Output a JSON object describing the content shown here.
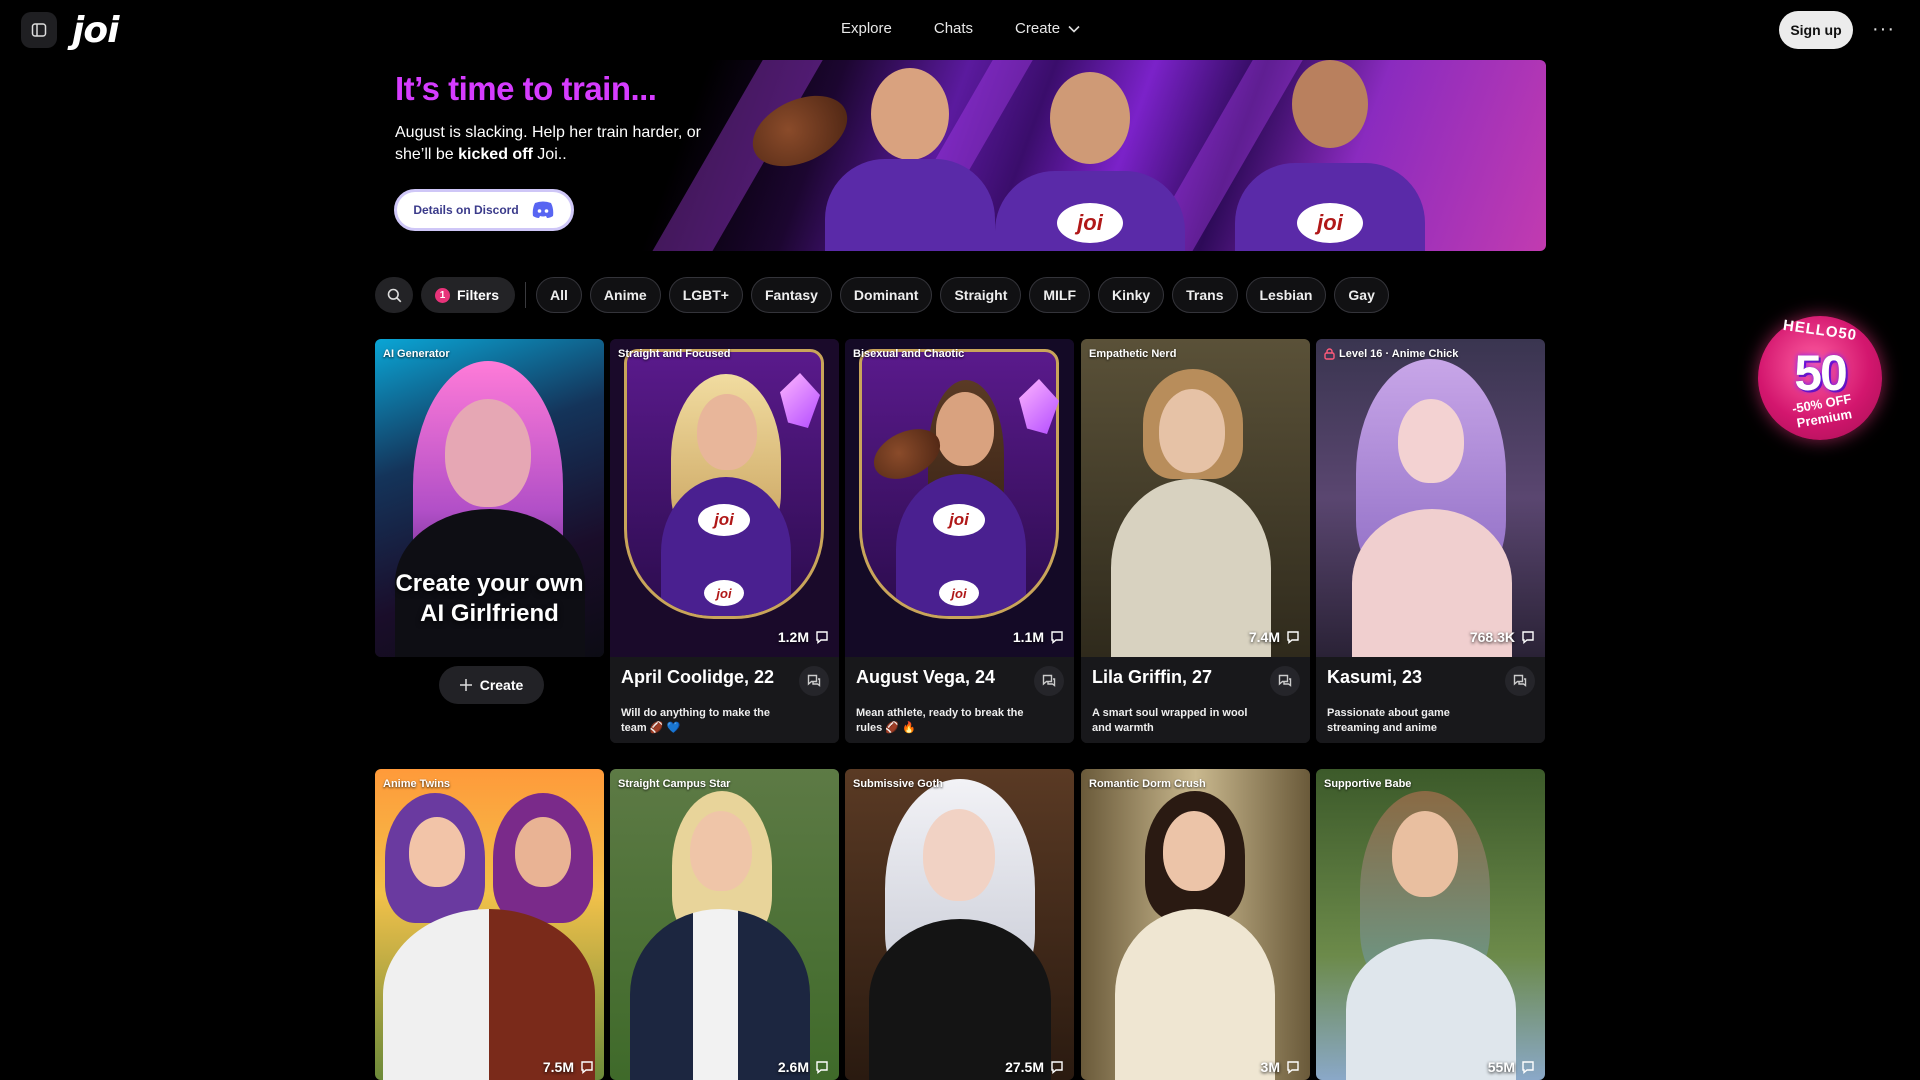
{
  "header": {
    "logo": "joi",
    "nav": [
      {
        "label": "Explore"
      },
      {
        "label": "Chats"
      },
      {
        "label": "Create"
      }
    ],
    "signup_label": "Sign up",
    "more_label": "···"
  },
  "banner": {
    "title": "It’s time to train...",
    "subtitle_start": "August is slacking. Help her train harder, or she’ll be ",
    "subtitle_bold": "kicked off",
    "subtitle_end": " Joi..",
    "button_label": "Details on Discord",
    "jersey_logo": "joi"
  },
  "filters": {
    "filters_label": "Filters",
    "filters_count": "1",
    "chips": [
      "All",
      "Anime",
      "LGBT+",
      "Fantasy",
      "Dominant",
      "Straight",
      "MILF",
      "Kinky",
      "Trans",
      "Lesbian",
      "Gay"
    ]
  },
  "generator": {
    "tag": "AI Generator",
    "headline_line1": "Create your own",
    "headline_line2": "AI Girlfriend",
    "create_label": "Create"
  },
  "cards_row1": [
    {
      "tag": "Straight and Focused",
      "count": "1.2M",
      "name": "April Coolidge, 22",
      "desc": "Will do anything to make the team 🏈 💙"
    },
    {
      "tag": "Bisexual and Chaotic",
      "count": "1.1M",
      "name": "August Vega, 24",
      "desc": "Mean athlete, ready to break the rules 🏈 🔥"
    },
    {
      "tag": "Empathetic Nerd",
      "count": "7.4M",
      "name": "Lila Griffin, 27",
      "desc": "A smart soul wrapped in wool and warmth"
    },
    {
      "tag": "Level 16 · Anime Chick",
      "count": "768.3K",
      "name": "Kasumi, 23",
      "desc": "Passionate about game streaming and anime"
    }
  ],
  "cards_row2": [
    {
      "tag": "Anime Twins",
      "count": "7.5M"
    },
    {
      "tag": "Straight Campus Star",
      "count": "2.6M"
    },
    {
      "tag": "Submissive Goth",
      "count": "27.5M"
    },
    {
      "tag": "Romantic Dorm Crush",
      "count": "3M"
    },
    {
      "tag": "Supportive Babe",
      "count": "55M"
    }
  ],
  "promo": {
    "code": "HELLO50",
    "big": "50",
    "off_text": "-50% OFF Premium"
  },
  "colors": {
    "accent_pink": "#e8337a",
    "banner_title": "#d63cff"
  }
}
